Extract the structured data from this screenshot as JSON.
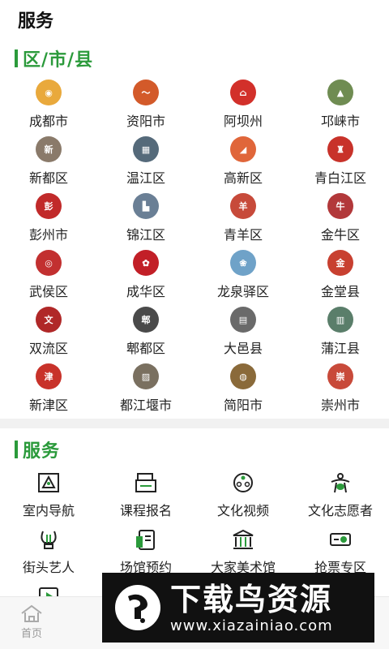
{
  "page_title": "服务",
  "district_section": {
    "title": "区/市/县",
    "items": [
      {
        "label": "成都市",
        "color": "#e9a93c",
        "mark": "◉"
      },
      {
        "label": "资阳市",
        "color": "#d35a2a",
        "mark": "〜"
      },
      {
        "label": "阿坝州",
        "color": "#d2302a",
        "mark": "⌂"
      },
      {
        "label": "邛崃市",
        "color": "#6f8c52",
        "mark": "▲"
      },
      {
        "label": "新都区",
        "color": "#8a7a6a",
        "mark": "新"
      },
      {
        "label": "温江区",
        "color": "#556a7a",
        "mark": "▦"
      },
      {
        "label": "高新区",
        "color": "#e0663a",
        "mark": "◢"
      },
      {
        "label": "青白江区",
        "color": "#c8322a",
        "mark": "♜"
      },
      {
        "label": "彭州市",
        "color": "#c12a2a",
        "mark": "彭"
      },
      {
        "label": "锦江区",
        "color": "#6a7f95",
        "mark": "▙"
      },
      {
        "label": "青羊区",
        "color": "#c74a3a",
        "mark": "羊"
      },
      {
        "label": "金牛区",
        "color": "#b2383a",
        "mark": "牛"
      },
      {
        "label": "武侯区",
        "color": "#c23030",
        "mark": "◎"
      },
      {
        "label": "成华区",
        "color": "#c21f27",
        "mark": "✿"
      },
      {
        "label": "龙泉驿区",
        "color": "#6fa2c8",
        "mark": "❀"
      },
      {
        "label": "金堂县",
        "color": "#c84030",
        "mark": "金"
      },
      {
        "label": "双流区",
        "color": "#b02828",
        "mark": "文"
      },
      {
        "label": "郫都区",
        "color": "#4a4a4a",
        "mark": "郫"
      },
      {
        "label": "大邑县",
        "color": "#6a6a6a",
        "mark": "▤"
      },
      {
        "label": "蒲江县",
        "color": "#5a7e6a",
        "mark": "▥"
      },
      {
        "label": "新津区",
        "color": "#c8322a",
        "mark": "津"
      },
      {
        "label": "都江堰市",
        "color": "#7a7060",
        "mark": "▨"
      },
      {
        "label": "简阳市",
        "color": "#8a6a3a",
        "mark": "◍"
      },
      {
        "label": "崇州市",
        "color": "#c84a3a",
        "mark": "崇"
      }
    ]
  },
  "service_section": {
    "title": "服务",
    "items": [
      {
        "label": "室内导航",
        "icon": "map-pin-icon"
      },
      {
        "label": "课程报名",
        "icon": "course-signup-icon"
      },
      {
        "label": "文化视频",
        "icon": "film-reel-icon"
      },
      {
        "label": "文化志愿者",
        "icon": "volunteer-icon"
      },
      {
        "label": "街头艺人",
        "icon": "lyre-icon"
      },
      {
        "label": "场馆预约",
        "icon": "booking-document-icon"
      },
      {
        "label": "大家美术馆",
        "icon": "museum-icon"
      },
      {
        "label": "抢票专区",
        "icon": "ticket-icon"
      },
      {
        "label": "",
        "icon": "video-play-icon"
      }
    ]
  },
  "bottom_nav": {
    "home_label": "首页"
  },
  "watermark": {
    "title": "下载鸟资源",
    "url": "www.xiazainiao.com"
  },
  "accent_color": "#2b9a3b"
}
